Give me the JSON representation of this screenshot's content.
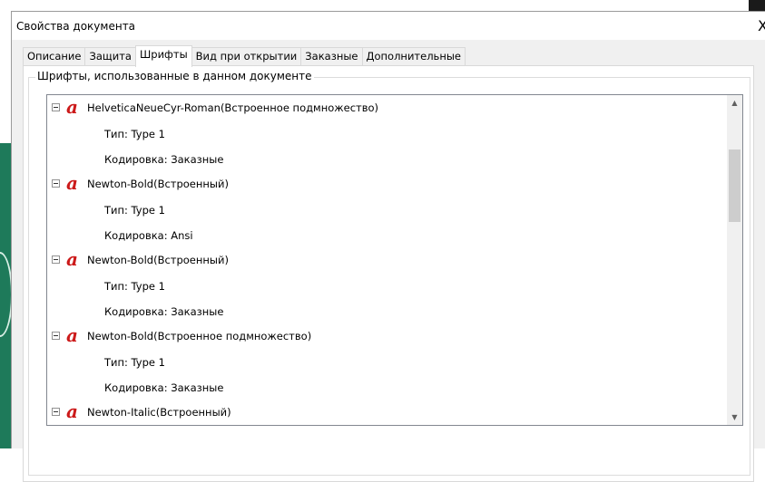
{
  "dialog": {
    "title": "Свойства документа",
    "close_label": "X"
  },
  "tabs": [
    {
      "label": "Описание",
      "active": false
    },
    {
      "label": "Защита",
      "active": false
    },
    {
      "label": "Шрифты",
      "active": true
    },
    {
      "label": "Вид при открытии",
      "active": false
    },
    {
      "label": "Заказные",
      "active": false
    },
    {
      "label": "Дополнительные",
      "active": false
    }
  ],
  "fonts_group": {
    "legend": "Шрифты, использованные в данном документе"
  },
  "font_icon_glyph": "a",
  "font_icon_name": "acrobat-font-icon",
  "font_icon_color": "#cc1a1a",
  "fonts": [
    {
      "name": "HelveticaNeueCyr-Roman(Встроенное подмножество)",
      "type": "Тип: Type 1",
      "encoding": "Кодировка: Заказные"
    },
    {
      "name": "Newton-Bold(Встроенный)",
      "type": "Тип: Type 1",
      "encoding": "Кодировка: Ansi"
    },
    {
      "name": "Newton-Bold(Встроенный)",
      "type": "Тип: Type 1",
      "encoding": "Кодировка: Заказные"
    },
    {
      "name": "Newton-Bold(Встроенное подмножество)",
      "type": "Тип: Type 1",
      "encoding": "Кодировка: Заказные"
    },
    {
      "name": "Newton-Italic(Встроенный)"
    }
  ],
  "scrollbar": {
    "up_arrow": "▲",
    "down_arrow": "▼"
  }
}
